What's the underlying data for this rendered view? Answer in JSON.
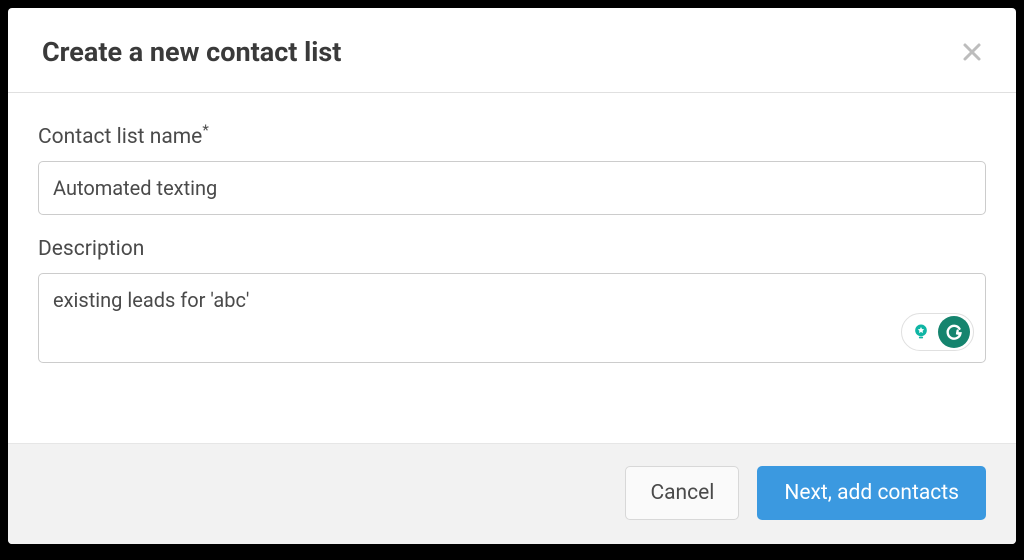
{
  "modal": {
    "title": "Create a new contact list",
    "fields": {
      "name": {
        "label": "Contact list name",
        "required_mark": "*",
        "value": "Automated texting"
      },
      "description": {
        "label": "Description",
        "value": "existing leads for 'abc'"
      }
    },
    "footer": {
      "cancel_label": "Cancel",
      "next_label": "Next, add contacts"
    }
  },
  "colors": {
    "primary_button": "#3b99e0",
    "grammarly_green": "#15846e",
    "lightbulb_teal": "#0fb5a4"
  }
}
